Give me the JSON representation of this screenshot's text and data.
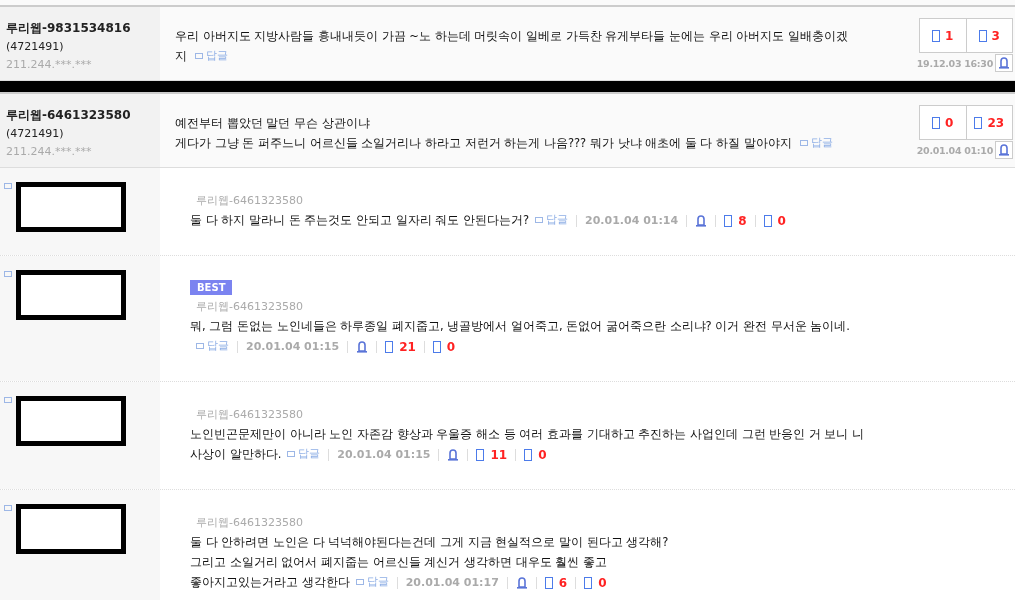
{
  "comments": [
    {
      "author": "루리웹-9831534816",
      "user_id": "(4721491)",
      "ip": "211.244.***.***",
      "lines": [
        "우리 아버지도 지방사람들 흉내내듯이 가끔 ~노 하는데 머릿속이 일베로 가득찬 유게부타들 눈에는 우리 아버지도 일배충이겠",
        "지"
      ],
      "reply_label": "답글",
      "upvotes": "1",
      "downvotes": "3",
      "date": "19.12.03 16:30"
    },
    {
      "author": "루리웹-6461323580",
      "user_id": "(4721491)",
      "ip": "211.244.***.***",
      "lines": [
        "예전부터 뽑았던 말던 무슨 상관이냐",
        "게다가 그냥 돈 퍼주느니 어르신들 소일거리나 하라고 저런거 하는게 나음??? 뭐가 낫냐 애초에 둘 다 하질 말아야지"
      ],
      "reply_label": "답글",
      "upvotes": "0",
      "downvotes": "23",
      "date": "20.01.04 01:10"
    }
  ],
  "replies": [
    {
      "author": "루리웹-6461323580",
      "lines": [
        "둘 다 하지 말라니 돈 주는것도 안되고 일자리 줘도 안된다는거?"
      ],
      "reply_label": "답글",
      "date": "20.01.04 01:14",
      "upvotes": "8",
      "downvotes": "0"
    },
    {
      "badge": "BEST",
      "author": "루리웹-6461323580",
      "lines": [
        "뭐, 그럼 돈없는 노인네들은 하루종일 폐지줍고, 냉골방에서 얼어죽고, 돈없어 굶어죽으란 소리냐? 이거 완전 무서운 놈이네."
      ],
      "reply_label": "답글",
      "date": "20.01.04 01:15",
      "upvotes": "21",
      "downvotes": "0"
    },
    {
      "author": "루리웹-6461323580",
      "lines": [
        "노인빈곤문제만이 아니라 노인 자존감 향상과 우울증 해소 등 여러 효과를 기대하고 추진하는 사업인데 그런 반응인 거 보니 니",
        "사상이 알만하다."
      ],
      "reply_label": "답글",
      "date": "20.01.04 01:15",
      "upvotes": "11",
      "downvotes": "0"
    },
    {
      "author": "루리웹-6461323580",
      "lines": [
        "둘 다 안하려면 노인은 다 넉넉해야된다는건데 그게 지금 현실적으로 말이 된다고 생각해?",
        "그리고 소일거리 없어서 폐지줍는 어르신들 계신거 생각하면 대우도 훨씬 좋고",
        "좋아지고있는거라고 생각한다"
      ],
      "reply_label": "답글",
      "date": "20.01.04 01:17",
      "upvotes": "6",
      "downvotes": "0"
    }
  ]
}
